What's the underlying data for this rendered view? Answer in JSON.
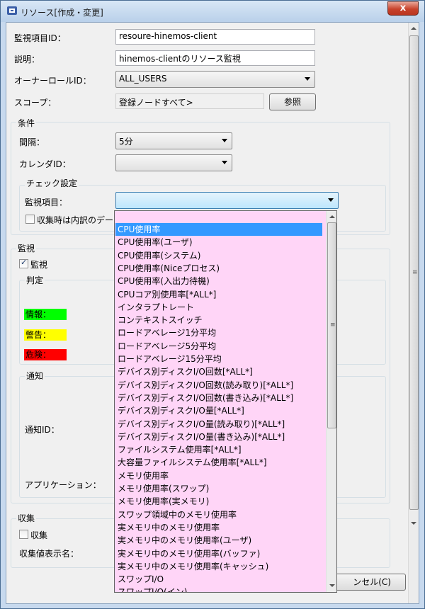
{
  "window": {
    "title": "リソース[作成・変更]",
    "close_glyph": "x"
  },
  "form": {
    "monitor_id_label": "監視項目ID：",
    "monitor_id_value": "resoure-hinemos-client",
    "desc_label": "説明：",
    "desc_value": "hinemos-clientのリソース監視",
    "owner_label": "オーナーロールID：",
    "owner_value": "ALL_USERS",
    "scope_label": "スコープ：",
    "scope_value": "登録ノードすべて>",
    "browse_button": "参照"
  },
  "conditions": {
    "group_label": "条件",
    "interval_label": "間隔：",
    "interval_value": "5分",
    "calendar_label": "カレンダID：",
    "calendar_value": "",
    "check_group_label": "チェック設定",
    "item_label": "監視項目：",
    "item_value": "",
    "collect_internal_label": "収集時は内訳のデータ"
  },
  "monitor": {
    "group_label": "監視",
    "enable_label": "監視",
    "judge_group_label": "判定",
    "info_label": "情報：",
    "warning_label": "警告：",
    "critical_label": "危険：",
    "colors": {
      "info": "#00ff00",
      "warning": "#ffff00",
      "critical": "#ff0000"
    }
  },
  "notify": {
    "group_label": "通知",
    "id_label": "通知ID：",
    "app_label": "アプリケーション："
  },
  "collect": {
    "group_label": "収集",
    "enable_label": "収集",
    "display_name_label": "収集値表示名："
  },
  "footer": {
    "cancel_fragment": "ンセル(C)"
  },
  "dropdown": {
    "background": "#ffd5f7",
    "selected_color": "#3399ff",
    "items": [
      "CPU使用率",
      "CPU使用率(ユーザ)",
      "CPU使用率(システム)",
      "CPU使用率(Niceプロセス)",
      "CPU使用率(入出力待機)",
      "CPUコア別使用率[*ALL*]",
      "インタラプトレート",
      "コンテキストスイッチ",
      "ロードアベレージ1分平均",
      "ロードアベレージ5分平均",
      "ロードアベレージ15分平均",
      "デバイス別ディスクI/O回数[*ALL*]",
      "デバイス別ディスクI/O回数(読み取り)[*ALL*]",
      "デバイス別ディスクI/O回数(書き込み)[*ALL*]",
      "デバイス別ディスクI/O量[*ALL*]",
      "デバイス別ディスクI/O量(読み取り)[*ALL*]",
      "デバイス別ディスクI/O量(書き込み)[*ALL*]",
      "ファイルシステム使用率[*ALL*]",
      "大容量ファイルシステム使用率[*ALL*]",
      "メモリ使用率",
      "メモリ使用率(スワップ)",
      "メモリ使用率(実メモリ)",
      "スワップ領域中のメモリ使用率",
      "実メモリ中のメモリ使用率",
      "実メモリ中のメモリ使用率(ユーザ)",
      "実メモリ中のメモリ使用率(バッファ)",
      "実メモリ中のメモリ使用率(キャッシュ)",
      "スワップI/O",
      "スワップI/O(イン)"
    ]
  }
}
